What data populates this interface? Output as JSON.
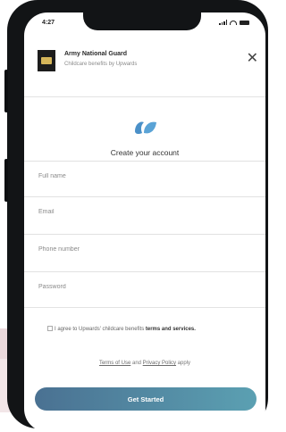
{
  "status_bar": {
    "time": "4:27"
  },
  "org": {
    "name": "Army National Guard",
    "subtitle": "Childcare benefits by Upwards",
    "close_glyph": "✕"
  },
  "brand": {
    "icon": "upwards-logo-icon",
    "color": "#4a90c8"
  },
  "form": {
    "title": "Create your account",
    "fields": {
      "full_name": {
        "placeholder": "Full name"
      },
      "email": {
        "placeholder": "Email"
      },
      "phone": {
        "placeholder": "Phone number"
      },
      "password": {
        "placeholder": "Password"
      }
    },
    "consent_text": "I agree to Upwards' childcare benefits ",
    "consent_bold": "terms and services.",
    "links": {
      "terms": "Terms of Use",
      "and": " and ",
      "privacy": "Privacy Policy",
      "apply": " apply"
    },
    "submit_label": "Get Started"
  },
  "colors": {
    "button_start": "#4a7192",
    "button_end": "#5ba0b2",
    "phone_frame": "#121416"
  }
}
